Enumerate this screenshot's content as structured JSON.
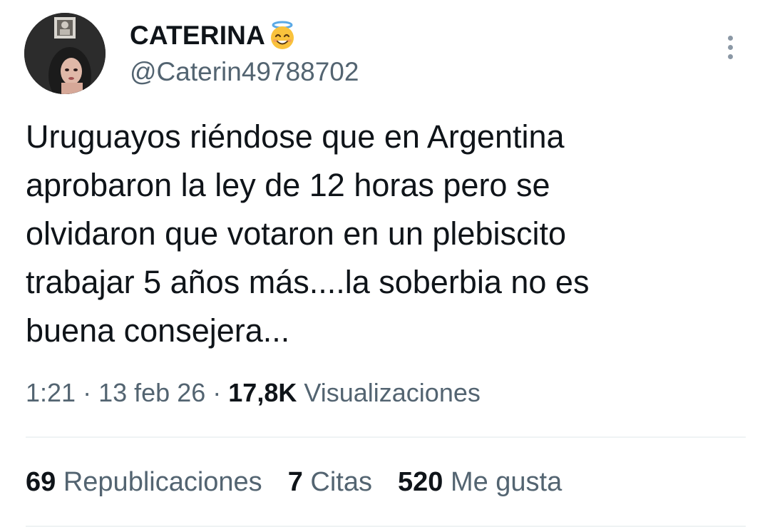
{
  "user": {
    "display_name": "CATERINA",
    "badge_emoji": "smiling-face-with-halo",
    "handle": "@Caterin49788702"
  },
  "tweet": {
    "text": "Uruguayos riéndose que en Argentina\naprobaron la ley de 12 horas pero se\nolvidaron que votaron en un plebiscito\ntrabajar 5 años más....la soberbia no es\nbuena consejera...",
    "time": "1:21",
    "date": "13 feb 26",
    "views_count": "17,8K",
    "views_label": "Visualizaciones",
    "separator": "·"
  },
  "stats": {
    "retweets": {
      "count": "69",
      "label": "Republicaciones"
    },
    "quotes": {
      "count": "7",
      "label": "Citas"
    },
    "likes": {
      "count": "520",
      "label": "Me gusta"
    }
  },
  "colors": {
    "text": "#0f1419",
    "secondary": "#536471",
    "divider": "#eff3f4"
  }
}
